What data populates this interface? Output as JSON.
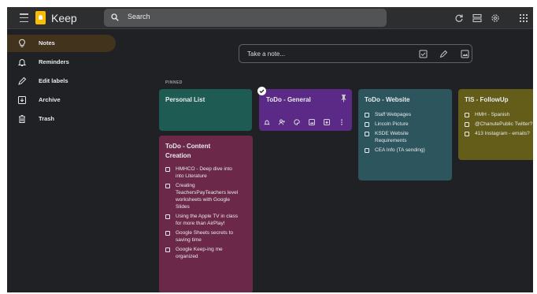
{
  "app": {
    "title": "Keep"
  },
  "search": {
    "placeholder": "Search"
  },
  "topbar_icons": [
    "refresh-icon",
    "list-view-icon",
    "settings-icon",
    "apps-grid-icon"
  ],
  "sidebar": {
    "items": [
      {
        "label": "Notes",
        "icon": "lightbulb-icon",
        "active": true
      },
      {
        "label": "Reminders",
        "icon": "bell-icon",
        "active": false
      },
      {
        "label": "Edit labels",
        "icon": "pencil-icon",
        "active": false
      },
      {
        "label": "Archive",
        "icon": "archive-icon",
        "active": false
      },
      {
        "label": "Trash",
        "icon": "trash-icon",
        "active": false
      }
    ]
  },
  "take_note": {
    "placeholder": "Take a note..."
  },
  "section": {
    "pinned_label": "PINNED"
  },
  "notes": [
    {
      "title": "Personal List",
      "color": "#1e5b52",
      "items": []
    },
    {
      "title": "ToDo - General",
      "color": "#5b2a86",
      "items": [],
      "pinned": true,
      "selected": true
    },
    {
      "title": "ToDo - Website",
      "color": "#2d555e",
      "items": [
        "Staff Webpages",
        "Lincoln Picture",
        "KSDE Website\nRequirements",
        "CEA Info (TA sending)"
      ]
    },
    {
      "title": "TIS - FollowUp",
      "color": "#635d19",
      "items": [
        "HMH - Spanish",
        "@ChanutePublic Twitter?",
        "413 Instagram - emails?"
      ]
    },
    {
      "title": "ToDo - Content\nCreation",
      "color": "#6c2848",
      "items": [
        "HMHCO - Deep dive into\ninto Literature",
        "Creating\nTeachersPayTeachers level\nworksheets with Google\nSlides",
        "Using the Apple TV in class\nfor more than AirPlay!",
        "Google Sheets secrets to\nsaving time",
        "Google Keep-ing me\norganized"
      ]
    }
  ],
  "colors": {
    "background": "#202124",
    "topbar": "#2d2e30",
    "active_nav": "#41331c",
    "brand_yellow": "#fbbc04"
  }
}
